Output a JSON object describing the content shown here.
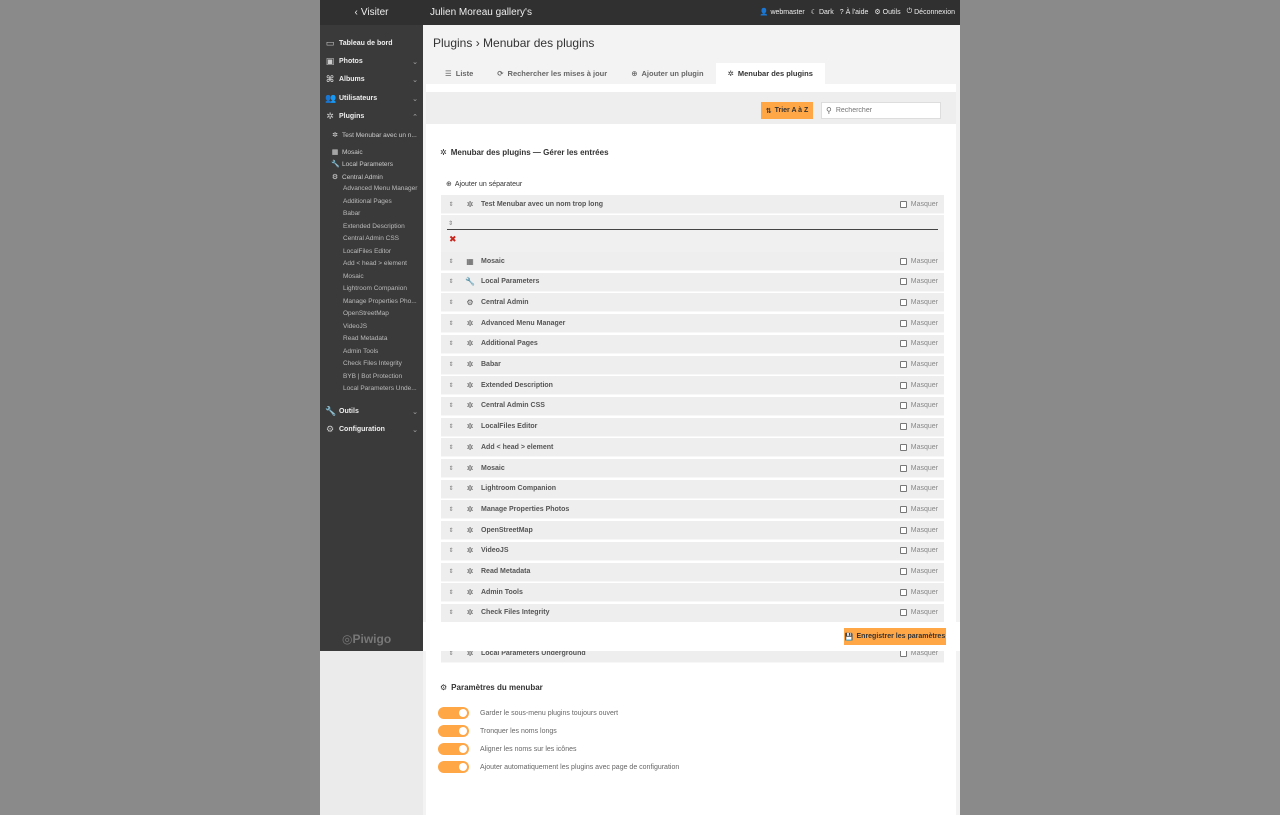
{
  "topbar": {
    "visit_label": "Visiter",
    "gallery_title": "Julien Moreau gallery's",
    "menu": [
      {
        "icon": "user-icon",
        "label": "webmaster"
      },
      {
        "icon": "moon-icon",
        "label": "Dark"
      },
      {
        "icon": "help-icon",
        "label": "À l'aide"
      },
      {
        "icon": "tools-icon",
        "label": "Outils"
      },
      {
        "icon": "logout-icon",
        "label": "Déconnexion"
      }
    ]
  },
  "sidebar": {
    "sections": [
      {
        "icon": "monitor-icon",
        "label": "Tableau de bord"
      },
      {
        "icon": "photo-icon",
        "label": "Photos"
      },
      {
        "icon": "albums-icon",
        "label": "Albums"
      },
      {
        "icon": "users-icon",
        "label": "Utilisateurs"
      },
      {
        "icon": "puzzle-icon",
        "label": "Plugins"
      },
      {
        "icon": "wrench-icon",
        "label": "Outils"
      },
      {
        "icon": "gear-icon",
        "label": "Configuration"
      }
    ],
    "plugin_items": [
      {
        "icon": "puzzle-icon",
        "label": "Test Menubar avec un n..."
      },
      {
        "icon": "grid-icon",
        "label": "Mosaic"
      },
      {
        "icon": "wrench-icon",
        "label": "Local Parameters"
      },
      {
        "icon": "gear-icon",
        "label": "Central Admin"
      }
    ],
    "sub_items": [
      "Advanced Menu Manager",
      "Additional Pages",
      "Babar",
      "Extended Description",
      "Central Admin CSS",
      "LocalFiles Editor",
      "Add < head > element",
      "Mosaic",
      "Lightroom Companion",
      "Manage Properties Pho...",
      "OpenStreetMap",
      "VideoJS",
      "Read Metadata",
      "Admin Tools",
      "Check Files Integrity",
      "BYB | Bot Protection",
      "Local Parameters Unde..."
    ],
    "logo": "Piwigo"
  },
  "main": {
    "title": "Plugins › Menubar des plugins",
    "tabs": [
      {
        "icon": "list-icon",
        "label": "Liste"
      },
      {
        "icon": "refresh-icon",
        "label": "Rechercher les mises à jour"
      },
      {
        "icon": "add-circle-icon",
        "label": "Ajouter un plugin"
      },
      {
        "icon": "puzzle-icon",
        "label": "Menubar des plugins"
      }
    ],
    "sort_label": "Trier A à Z",
    "search_placeholder": "Rechercher",
    "section_title": "Menubar des plugins — Gérer les entrées",
    "add_separator": "Ajouter un séparateur",
    "mask_label": "Masquer",
    "first_entry": {
      "icon": "puzzle-icon",
      "name": "Test Menubar avec un nom trop long"
    },
    "entries": [
      {
        "icon": "grid-icon",
        "name": "Mosaic"
      },
      {
        "icon": "wrench-icon",
        "name": "Local Parameters"
      },
      {
        "icon": "gear-icon",
        "name": "Central Admin"
      },
      {
        "icon": "puzzle-icon",
        "name": "Advanced Menu Manager"
      },
      {
        "icon": "puzzle-icon",
        "name": "Additional Pages"
      },
      {
        "icon": "puzzle-icon",
        "name": "Babar"
      },
      {
        "icon": "puzzle-icon",
        "name": "Extended Description"
      },
      {
        "icon": "puzzle-icon",
        "name": "Central Admin CSS"
      },
      {
        "icon": "puzzle-icon",
        "name": "LocalFiles Editor"
      },
      {
        "icon": "puzzle-icon",
        "name": "Add < head > element"
      },
      {
        "icon": "puzzle-icon",
        "name": "Mosaic"
      },
      {
        "icon": "puzzle-icon",
        "name": "Lightroom Companion"
      },
      {
        "icon": "puzzle-icon",
        "name": "Manage Properties Photos"
      },
      {
        "icon": "puzzle-icon",
        "name": "OpenStreetMap"
      },
      {
        "icon": "puzzle-icon",
        "name": "VideoJS"
      },
      {
        "icon": "puzzle-icon",
        "name": "Read Metadata"
      },
      {
        "icon": "puzzle-icon",
        "name": "Admin Tools"
      },
      {
        "icon": "puzzle-icon",
        "name": "Check Files Integrity"
      }
    ],
    "last_entry": {
      "icon": "puzzle-icon",
      "name": "Local Parameters Underground"
    },
    "save_label": "Enregistrer les paramètres",
    "params_title": "Paramètres du menubar",
    "toggles": [
      {
        "label": "Garder le sous-menu plugins toujours ouvert",
        "on": true
      },
      {
        "label": "Tronquer les noms longs",
        "on": true
      },
      {
        "label": "Aligner les noms sur les icônes",
        "on": true
      },
      {
        "label": "Ajouter automatiquement les plugins avec page de configuration",
        "on": true
      }
    ]
  },
  "colors": {
    "accent": "#ffa646",
    "topbar": "#303030",
    "sidebar": "#3a3a3a",
    "delete": "#c8251c"
  }
}
